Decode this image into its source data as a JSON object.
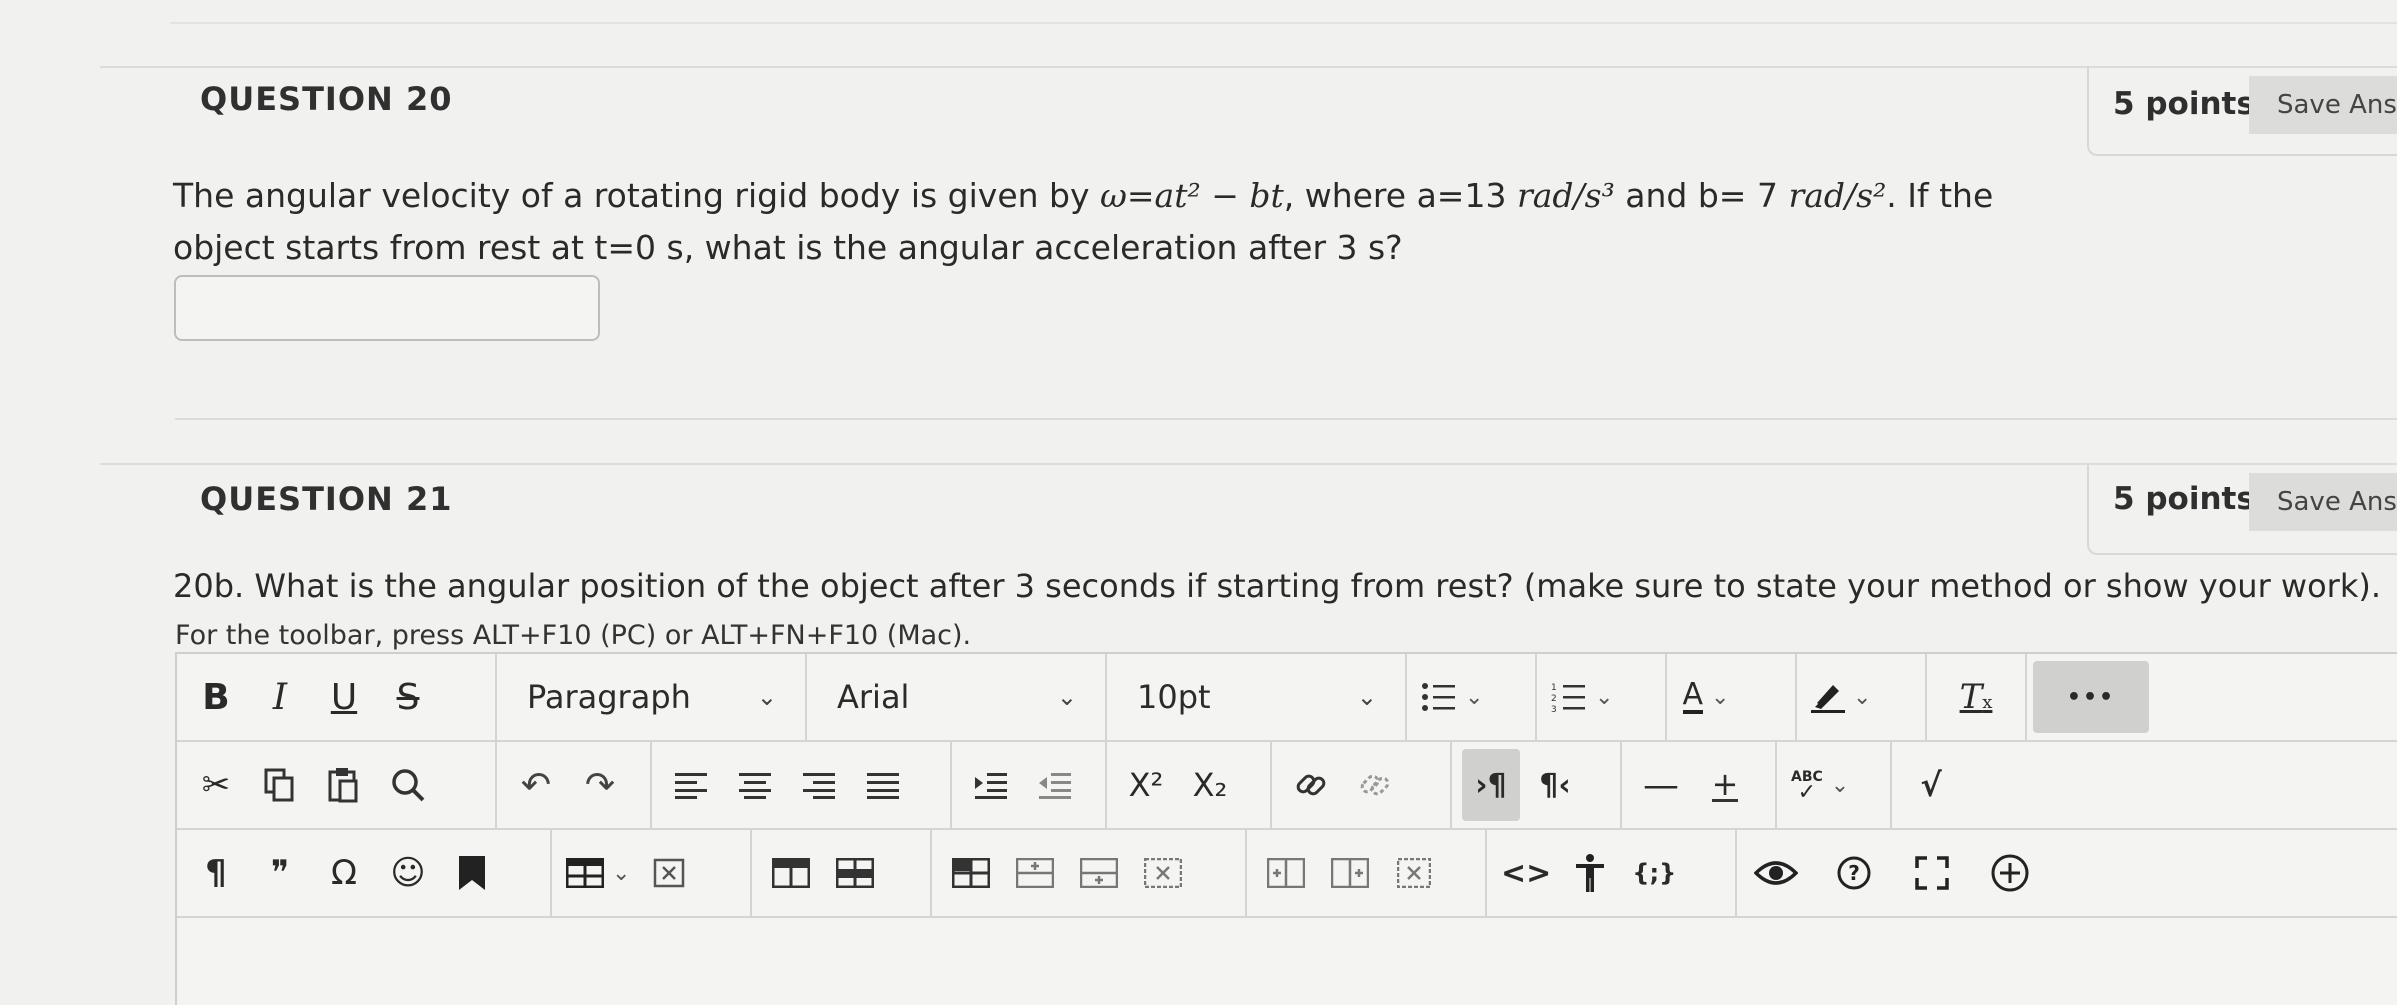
{
  "q20": {
    "title": "QUESTION 20",
    "points": "5 points",
    "save_label": "Save Answer",
    "text_1": "The angular velocity of a rotating rigid body is given by ",
    "formula": "ω=at² − bt",
    "text_2": ", where a=13 ",
    "unit_a": "rad/s³",
    "text_3": " and b= 7 ",
    "unit_b": "rad/s²",
    "text_4": ". If the",
    "text_line2": "object starts from rest at t=0 s, what is the angular acceleration after 3 s?",
    "answer_value": ""
  },
  "q21": {
    "title": "QUESTION 21",
    "points": "5 points",
    "save_label": "Save Answer",
    "text": "20b. What is the angular position of the object after 3 seconds if starting from rest? (make sure to state your method or show your work).",
    "hint": "For the toolbar, press ALT+F10 (PC) or ALT+FN+F10 (Mac)."
  },
  "toolbar": {
    "bold": "B",
    "italic": "I",
    "underline": "U",
    "strike": "S",
    "paragraph": "Paragraph",
    "font": "Arial",
    "size": "10pt",
    "more": "•••",
    "superscript": "X²",
    "subscript": "X₂",
    "ltr": "›¶",
    "rtl": "¶‹",
    "spell": "ABC",
    "pilcrow": "¶",
    "quote": "❞",
    "omega": "Ω",
    "code": "<>",
    "braces": "{;}",
    "chev": "⌄"
  }
}
